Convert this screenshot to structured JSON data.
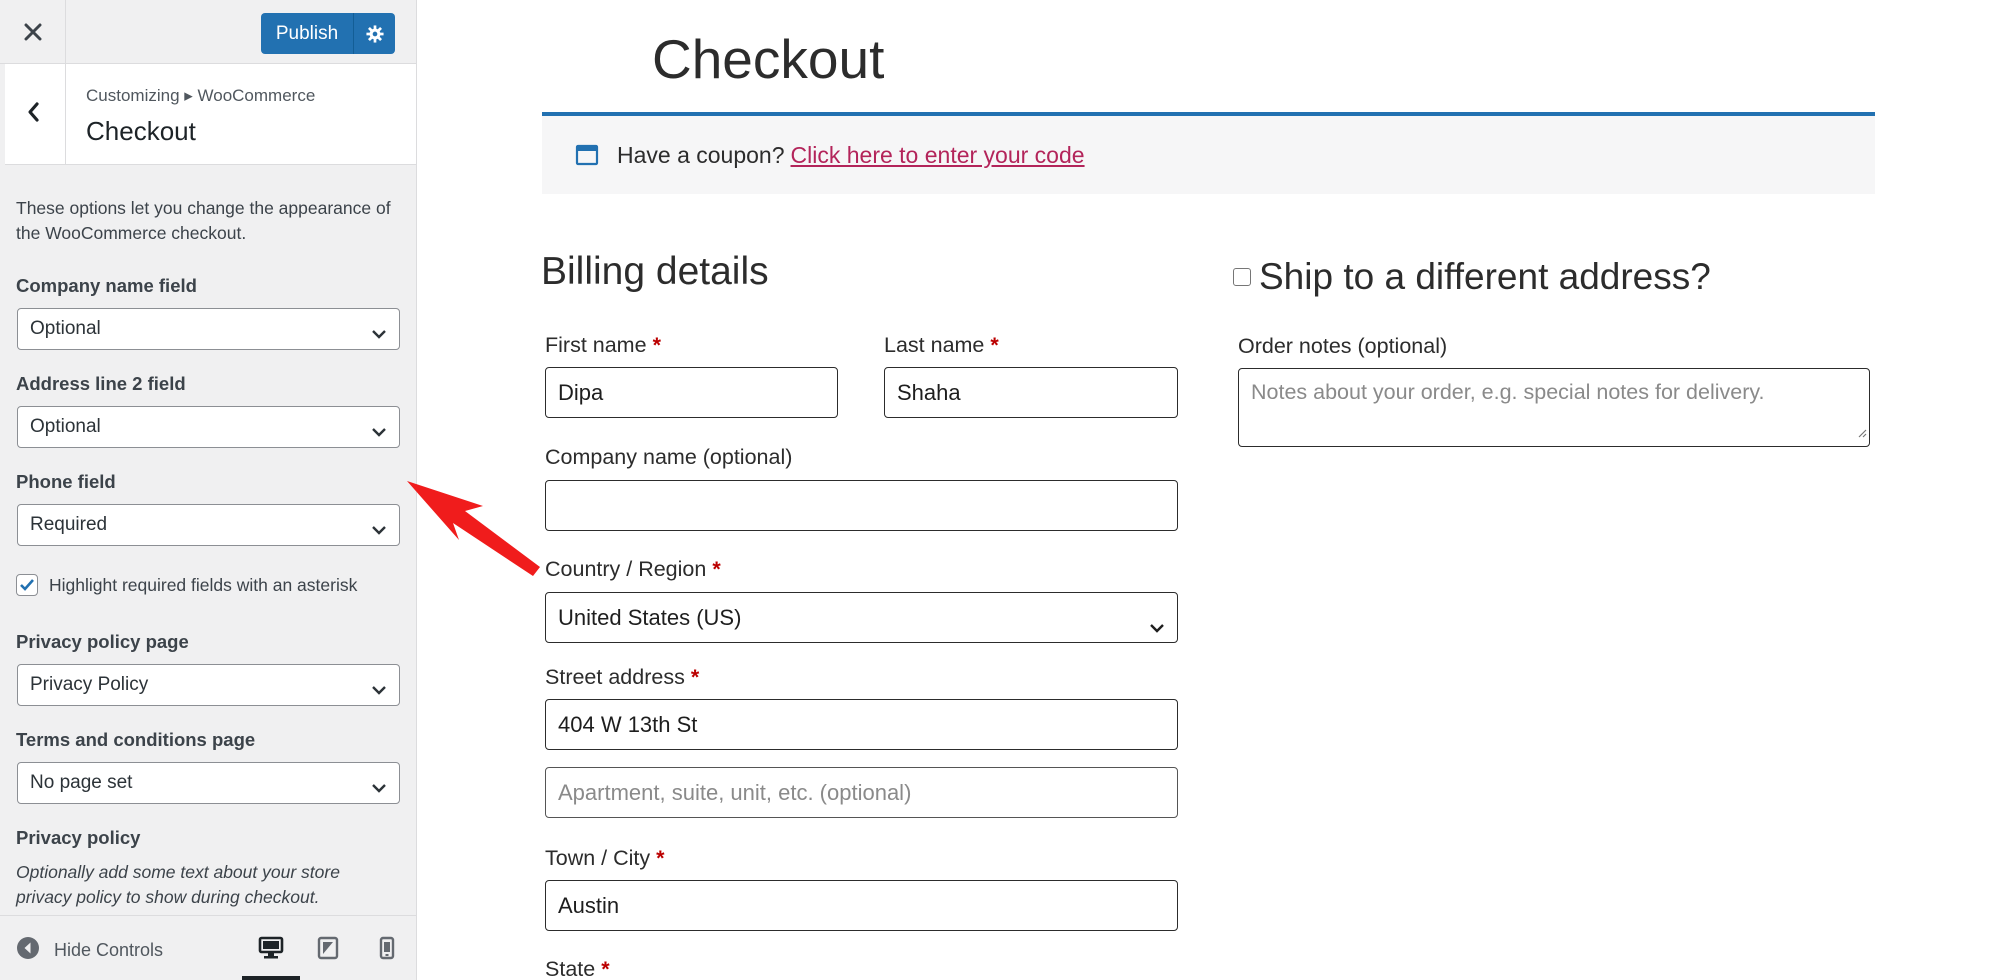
{
  "customizer": {
    "close_icon": "close-icon",
    "publish_label": "Publish",
    "publish_gear_icon": "gear-icon",
    "breadcrumb": "Customizing ▸ WooCommerce",
    "section_title": "Checkout",
    "description": "These options let you change the appearance of the WooCommerce checkout.",
    "fields": {
      "company": {
        "label": "Company name field",
        "value": "Optional"
      },
      "address2": {
        "label": "Address line 2 field",
        "value": "Optional"
      },
      "phone": {
        "label": "Phone field",
        "value": "Required"
      },
      "privacy_page": {
        "label": "Privacy policy page",
        "value": "Privacy Policy"
      },
      "terms_page": {
        "label": "Terms and conditions page",
        "value": "No page set"
      }
    },
    "highlight_asterisk": {
      "label": "Highlight required fields with an asterisk",
      "checked": true
    },
    "privacy_policy": {
      "label": "Privacy policy",
      "note": "Optionally add some text about your store privacy policy to show during checkout."
    },
    "footer": {
      "hide_controls_label": "Hide Controls",
      "devices": [
        "desktop",
        "tablet",
        "mobile"
      ],
      "active_device": "desktop"
    }
  },
  "preview": {
    "page_title": "Checkout",
    "coupon": {
      "text": "Have a coupon?",
      "link": "Click here to enter your code"
    },
    "billing_title": "Billing details",
    "ship_different": {
      "label": "Ship to a different address?",
      "checked": false
    },
    "first_name": {
      "label": "First name",
      "value": "Dipa"
    },
    "last_name": {
      "label": "Last name",
      "value": "Shaha"
    },
    "company": {
      "label": "Company name (optional)",
      "value": ""
    },
    "country": {
      "label": "Country / Region",
      "value": "United States (US)"
    },
    "street": {
      "label": "Street address",
      "value": "404 W 13th St",
      "placeholder2": "Apartment, suite, unit, etc. (optional)"
    },
    "city": {
      "label": "Town / City",
      "value": "Austin"
    },
    "state": {
      "label": "State"
    },
    "order_notes": {
      "label": "Order notes (optional)",
      "placeholder": "Notes about your order, e.g. special notes for delivery."
    },
    "required_mark": "*"
  },
  "colors": {
    "accent": "#2271b1",
    "link": "#b3245a",
    "required": "#bb0000",
    "arrow": "#f01c1c"
  }
}
